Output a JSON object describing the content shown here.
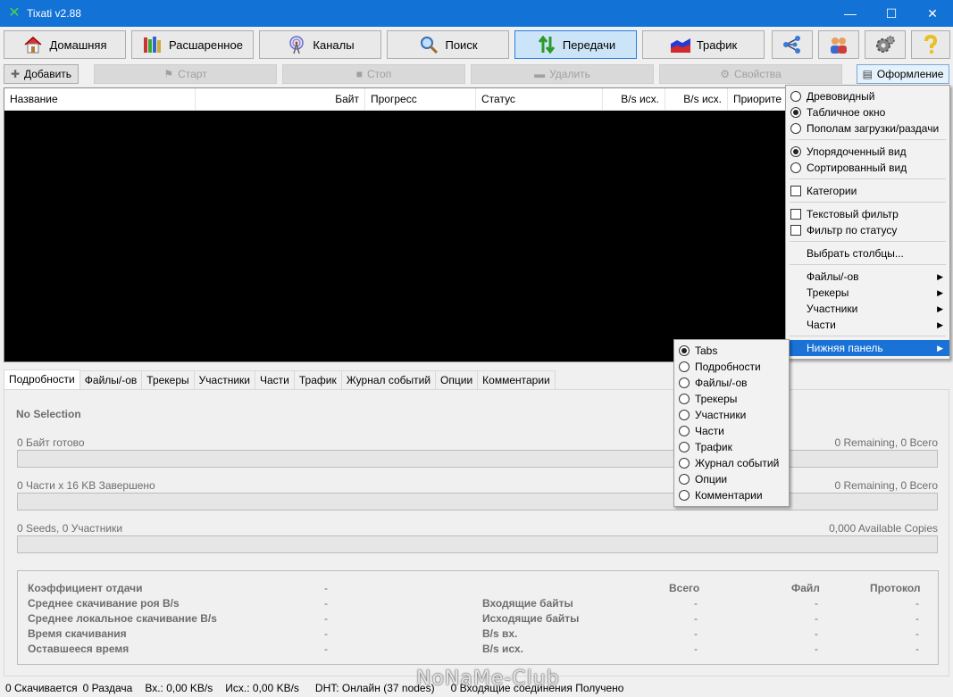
{
  "window": {
    "title": "Tixati v2.88",
    "controls": [
      "minimize",
      "maximize",
      "close"
    ]
  },
  "toolbar": {
    "home": "Домашняя",
    "shared": "Расшаренное",
    "channels": "Каналы",
    "search": "Поиск",
    "transfers": "Передачи",
    "traffic": "Трафик",
    "active_tab": "Передачи"
  },
  "subtoolbar": {
    "add": "Добавить",
    "start": "Старт",
    "stop": "Стоп",
    "delete": "Удалить",
    "properties": "Свойства",
    "layout": "Оформление"
  },
  "list": {
    "columns": [
      "Название",
      "Байт",
      "Прогресс",
      "Статус",
      "B/s исх.",
      "B/s исх.",
      "Приорите"
    ]
  },
  "tabs": [
    "Подробности",
    "Файлы/-ов",
    "Трекеры",
    "Участники",
    "Части",
    "Трафик",
    "Журнал событий",
    "Опции",
    "Комментарии"
  ],
  "details": {
    "no_selection": "No Selection",
    "bytes_done": "0 Байт готово",
    "bytes_remaining": "0 Remaining,  0 Всего",
    "bytes_progress": 0,
    "pieces_done": "0 Части  x  16 KB Завершено",
    "pieces_remaining": "0 Remaining,  0 Всего",
    "pieces_progress": 0,
    "seeds": "0 Seeds, 0 Участники",
    "copies": "0,000 Available Copies",
    "copies_progress": 0,
    "stats_left": [
      {
        "label": "Коэффициент отдачи",
        "value": "-"
      },
      {
        "label": "Среднее скачивание роя B/s",
        "value": "-"
      },
      {
        "label": "Среднее локальное скачивание B/s",
        "value": "-"
      },
      {
        "label": "Время скачивания",
        "value": "-"
      },
      {
        "label": "Оставшееся время",
        "value": "-"
      }
    ],
    "stats_right_headers": [
      "Всего",
      "Файл",
      "Протокол"
    ],
    "stats_right": [
      {
        "label": "Входящие байты",
        "values": [
          "-",
          "-",
          "-"
        ]
      },
      {
        "label": "Исходящие байты",
        "values": [
          "-",
          "-",
          "-"
        ]
      },
      {
        "label": "B/s вх.",
        "values": [
          "-",
          "-",
          "-"
        ]
      },
      {
        "label": "B/s исх.",
        "values": [
          "-",
          "-",
          "-"
        ]
      }
    ]
  },
  "statusbar": {
    "downloading": "0 Скачивается",
    "seeding": "0 Раздача",
    "in_rate": "Вх.: 0,00 KB/s",
    "out_rate": "Исх.: 0,00 KB/s",
    "dht": "DHT: Онлайн (37 nodes)",
    "incoming": "0 Входящие соединения Получено"
  },
  "watermark": "NoNaMe-Club",
  "layout_menu": {
    "items": [
      {
        "type": "radio",
        "label": "Древовидный",
        "checked": false
      },
      {
        "type": "radio",
        "label": "Табличное окно",
        "checked": true
      },
      {
        "type": "radio",
        "label": "Пополам загрузки/раздачи",
        "checked": false
      },
      {
        "type": "sep"
      },
      {
        "type": "radio",
        "label": "Упорядоченный вид",
        "checked": true
      },
      {
        "type": "radio",
        "label": "Сортированный вид",
        "checked": false
      },
      {
        "type": "sep"
      },
      {
        "type": "check",
        "label": "Категории",
        "checked": false
      },
      {
        "type": "sep"
      },
      {
        "type": "check",
        "label": "Текстовый фильтр",
        "checked": false
      },
      {
        "type": "check",
        "label": "Фильтр по статусу",
        "checked": false
      },
      {
        "type": "sep"
      },
      {
        "type": "plain",
        "label": "Выбрать столбцы..."
      },
      {
        "type": "sep"
      },
      {
        "type": "sub",
        "label": "Файлы/-ов"
      },
      {
        "type": "sub",
        "label": "Трекеры"
      },
      {
        "type": "sub",
        "label": "Участники"
      },
      {
        "type": "sub",
        "label": "Части"
      },
      {
        "type": "sep"
      },
      {
        "type": "sub",
        "label": "Нижняя панель",
        "highlighted": true
      }
    ]
  },
  "bottom_panel_menu": {
    "items": [
      {
        "label": "Tabs",
        "checked": true
      },
      {
        "label": "Подробности",
        "checked": false
      },
      {
        "label": "Файлы/-ов",
        "checked": false
      },
      {
        "label": "Трекеры",
        "checked": false
      },
      {
        "label": "Участники",
        "checked": false
      },
      {
        "label": "Части",
        "checked": false
      },
      {
        "label": "Трафик",
        "checked": false
      },
      {
        "label": "Журнал событий",
        "checked": false
      },
      {
        "label": "Опции",
        "checked": false
      },
      {
        "label": "Комментарии",
        "checked": false
      }
    ]
  }
}
